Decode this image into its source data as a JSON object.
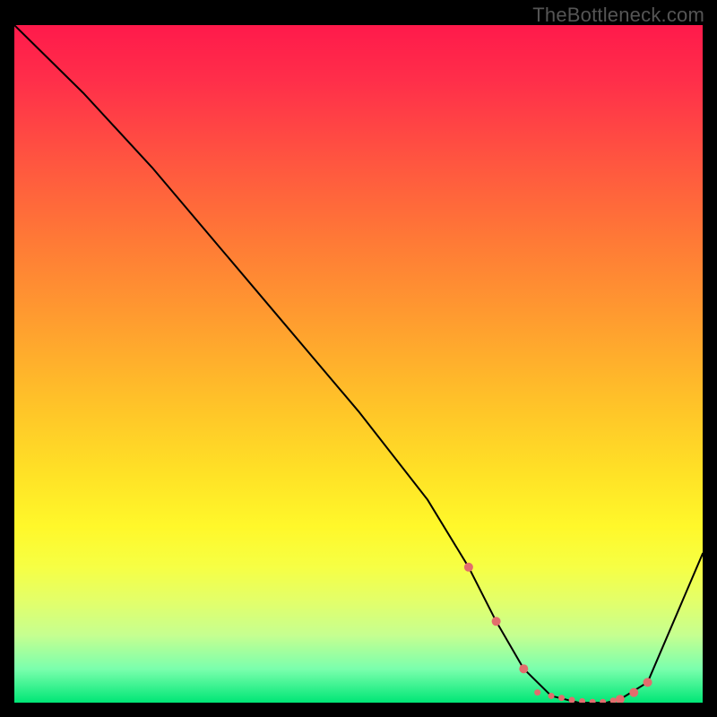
{
  "watermark": "TheBottleneck.com",
  "chart_data": {
    "type": "line",
    "title": "",
    "xlabel": "",
    "ylabel": "",
    "xlim": [
      0,
      100
    ],
    "ylim": [
      0,
      100
    ],
    "grid": false,
    "legend": false,
    "series": [
      {
        "name": "curve",
        "x": [
          0,
          4,
          10,
          20,
          30,
          40,
          50,
          60,
          66,
          70,
          74,
          78,
          82,
          86,
          88,
          92,
          100
        ],
        "y": [
          100,
          96,
          90,
          79,
          67,
          55,
          43,
          30,
          20,
          12,
          5,
          1,
          0,
          0,
          0.5,
          3,
          22
        ],
        "stroke": "#000000",
        "stroke_width": 2
      }
    ],
    "markers": {
      "name": "dots",
      "color": "#e26d6d",
      "radius_main": 5,
      "radius_small": 3.5,
      "points": [
        {
          "x": 66,
          "y": 20,
          "r": "main"
        },
        {
          "x": 70,
          "y": 12,
          "r": "main"
        },
        {
          "x": 74,
          "y": 5,
          "r": "main"
        },
        {
          "x": 76,
          "y": 1.5,
          "r": "small"
        },
        {
          "x": 78,
          "y": 1,
          "r": "small"
        },
        {
          "x": 79.5,
          "y": 0.7,
          "r": "small"
        },
        {
          "x": 81,
          "y": 0.4,
          "r": "small"
        },
        {
          "x": 82.5,
          "y": 0.2,
          "r": "small"
        },
        {
          "x": 84,
          "y": 0.1,
          "r": "small"
        },
        {
          "x": 85.5,
          "y": 0.1,
          "r": "small"
        },
        {
          "x": 87,
          "y": 0.3,
          "r": "small"
        },
        {
          "x": 88,
          "y": 0.5,
          "r": "main"
        },
        {
          "x": 90,
          "y": 1.5,
          "r": "main"
        },
        {
          "x": 92,
          "y": 3,
          "r": "main"
        }
      ]
    }
  }
}
